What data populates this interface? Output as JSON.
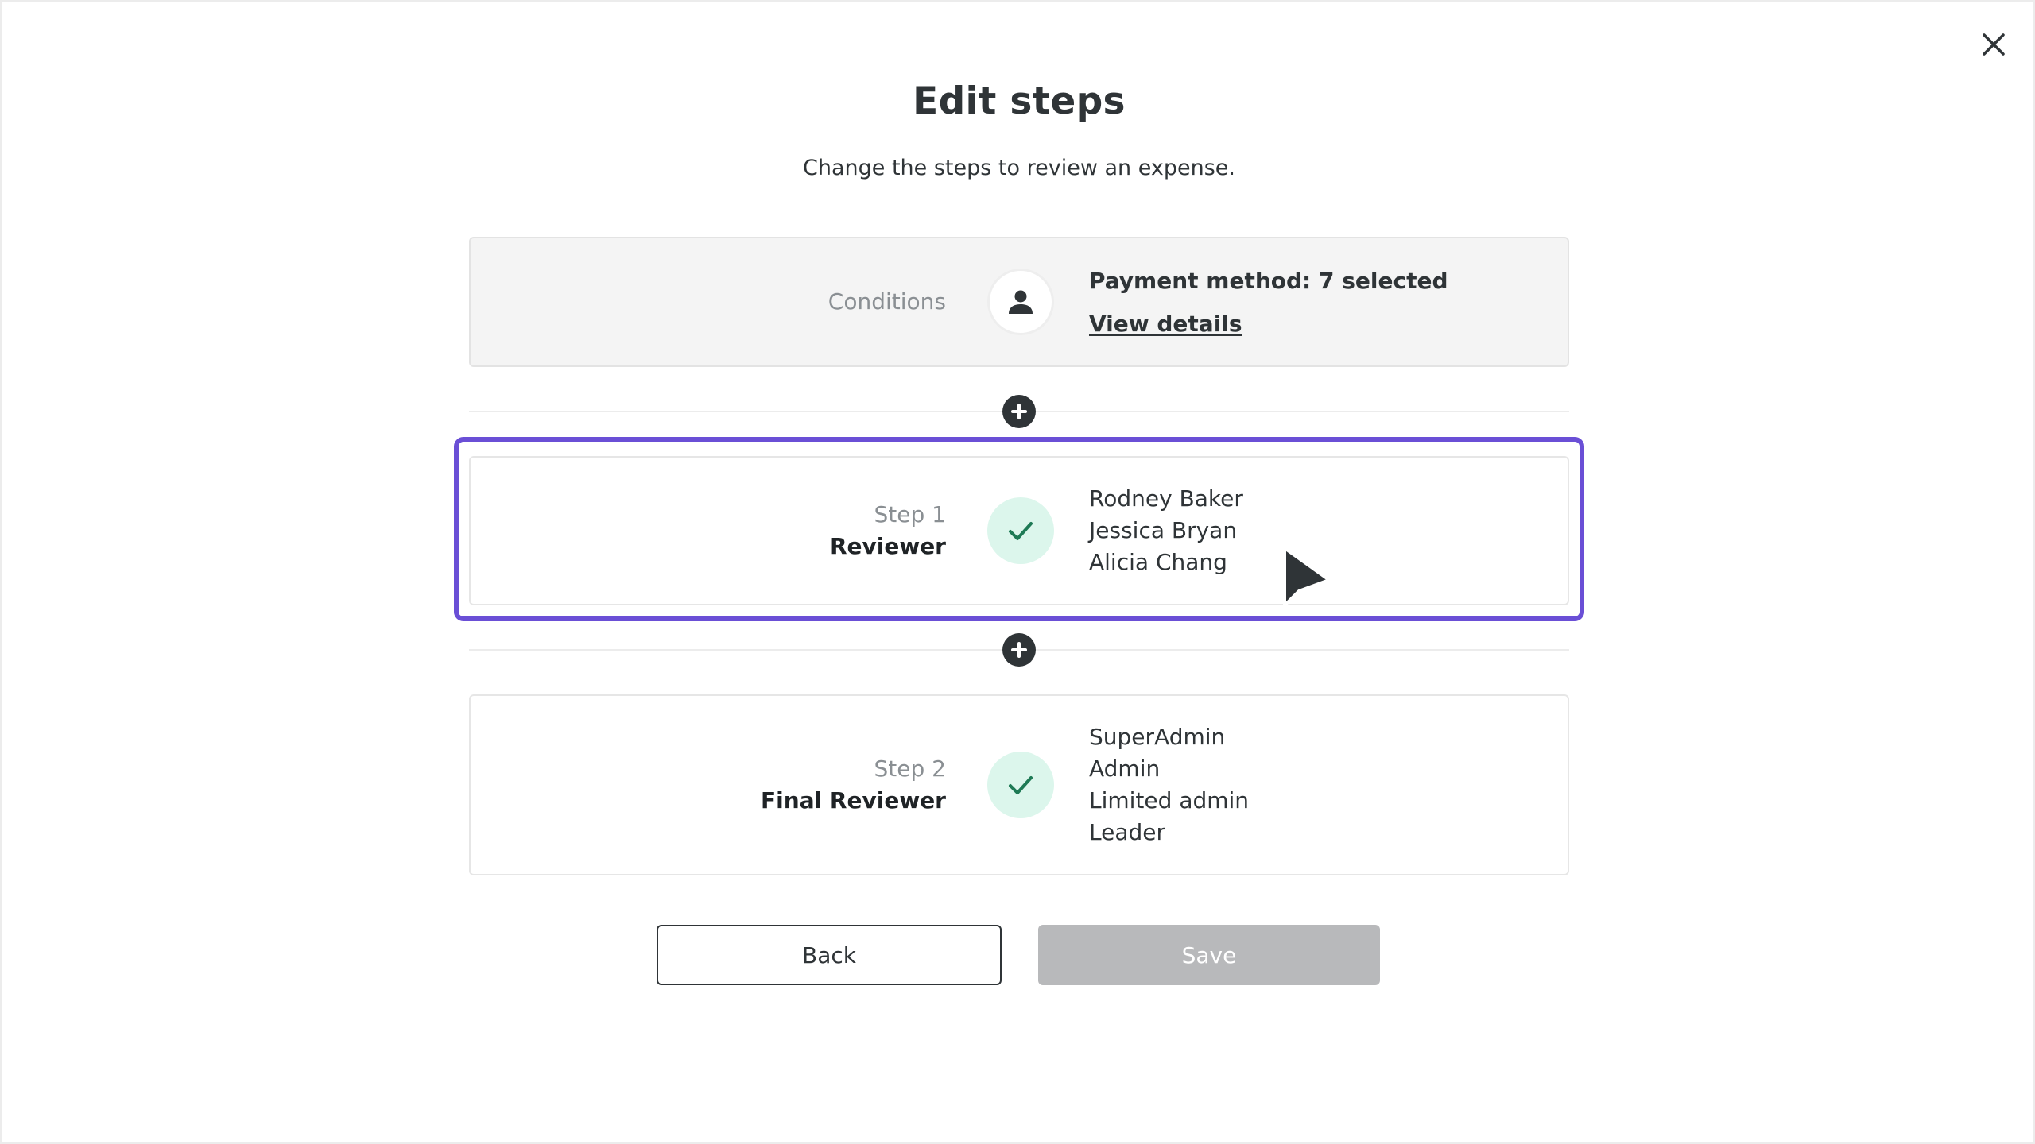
{
  "dialog": {
    "title": "Edit steps",
    "subtitle": "Change the steps to review an expense.",
    "close_icon": "close-icon"
  },
  "conditions": {
    "label": "Conditions",
    "icon": "person-icon",
    "summary": "Payment method: 7 selected",
    "link_label": "View details"
  },
  "steps": [
    {
      "step_label": "Step 1",
      "role": "Reviewer",
      "icon": "checkmark-icon",
      "members": [
        "Rodney Baker",
        "Jessica Bryan",
        "Alicia Chang"
      ],
      "selected": true
    },
    {
      "step_label": "Step 2",
      "role": "Final Reviewer",
      "icon": "checkmark-icon",
      "members": [
        "SuperAdmin",
        "Admin",
        "Limited admin",
        "Leader"
      ],
      "selected": false
    }
  ],
  "add_step_icon": "plus-circle-icon",
  "actions": {
    "back_label": "Back",
    "save_label": "Save",
    "save_enabled": false
  },
  "colors": {
    "selection": "#6a4fd6",
    "check_bg": "#dcf6ec",
    "check_fg": "#1e7a55",
    "save_disabled_bg": "#b8b9bb"
  }
}
